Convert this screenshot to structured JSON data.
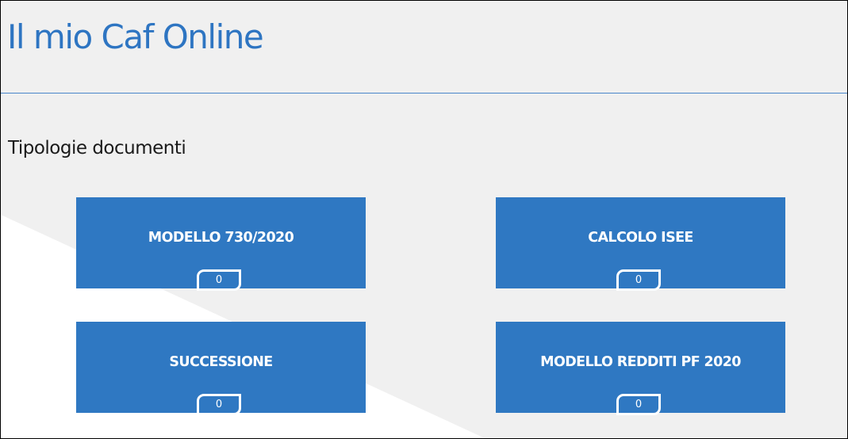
{
  "app": {
    "title": "Il mio Caf Online"
  },
  "main": {
    "section_title": "Tipologie documenti",
    "tiles": [
      {
        "label": "MODELLO 730/2020",
        "count": "0"
      },
      {
        "label": "CALCOLO ISEE",
        "count": "0"
      },
      {
        "label": "SUCCESSIONE",
        "count": "0"
      },
      {
        "label": "MODELLO REDDITI PF 2020",
        "count": "0"
      }
    ]
  },
  "colors": {
    "accent": "#2f78c2",
    "title_text": "#2e75c2",
    "background": "#f0f0f0",
    "background_wedge": "#ffffff"
  }
}
